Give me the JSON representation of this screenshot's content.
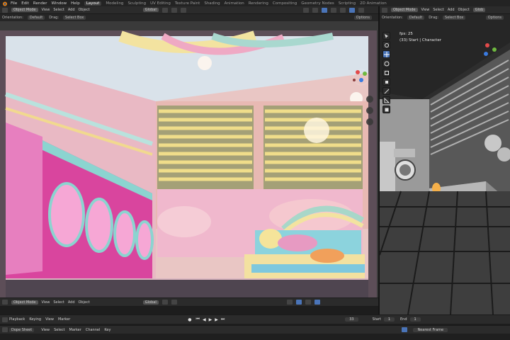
{
  "topbar": {
    "menus": [
      "File",
      "Edit",
      "Render",
      "Window",
      "Help"
    ],
    "workspaces": [
      "Layout",
      "Modeling",
      "Sculpting",
      "UV Editing",
      "Texture Paint",
      "Shading",
      "Animation",
      "Rendering",
      "Compositing",
      "Geometry Nodes",
      "Scripting",
      "2D Animation"
    ],
    "active_workspace": "Layout"
  },
  "left_viewport": {
    "header": {
      "mode": "Object Mode",
      "menus": [
        "View",
        "Select",
        "Add",
        "Object"
      ],
      "orientation": "Global"
    },
    "subheader": {
      "orientation_label": "Orientation:",
      "orientation_value": "Default",
      "drag_label": "Drag:",
      "drag_value": "Select Box",
      "options": "Options"
    }
  },
  "right_viewport": {
    "header": {
      "mode": "Object Mode",
      "menus": [
        "View",
        "Select",
        "Add",
        "Object"
      ],
      "orientation": "Glob"
    },
    "subheader": {
      "orientation_label": "Orientation:",
      "orientation_value": "Default",
      "drag_label": "Drag:",
      "drag_value": "Select Box",
      "options": "Options"
    },
    "overlay": {
      "fps": "fps: 25",
      "info": "(33) Start | Character"
    }
  },
  "middle_header": {
    "mode": "Object Mode",
    "menus": [
      "View",
      "Select",
      "Add",
      "Object"
    ],
    "orientation": "Global"
  },
  "timeline": {
    "playback": "Playback",
    "keying": "Keying",
    "view": "View",
    "marker": "Marker",
    "current_frame": "33",
    "start_label": "Start",
    "start_value": "1",
    "end_label": "End",
    "end_value": "1"
  },
  "dopesheet": {
    "mode": "Dope Sheet",
    "menus": [
      "View",
      "Select",
      "Marker",
      "Channel",
      "Key"
    ],
    "interpolation": "Nearest Frame"
  },
  "colors": {
    "accent": "#4a74b8",
    "header": "#2b2b2b",
    "background": "#1d1d1d"
  },
  "icons": [
    "blender-logo-icon",
    "cursor-icon",
    "move-icon",
    "rotate-icon",
    "scale-icon",
    "transform-icon",
    "annotate-icon",
    "measure-icon",
    "add-cube-icon",
    "play-icon",
    "zoom-icon",
    "hand-icon",
    "camera-icon"
  ]
}
